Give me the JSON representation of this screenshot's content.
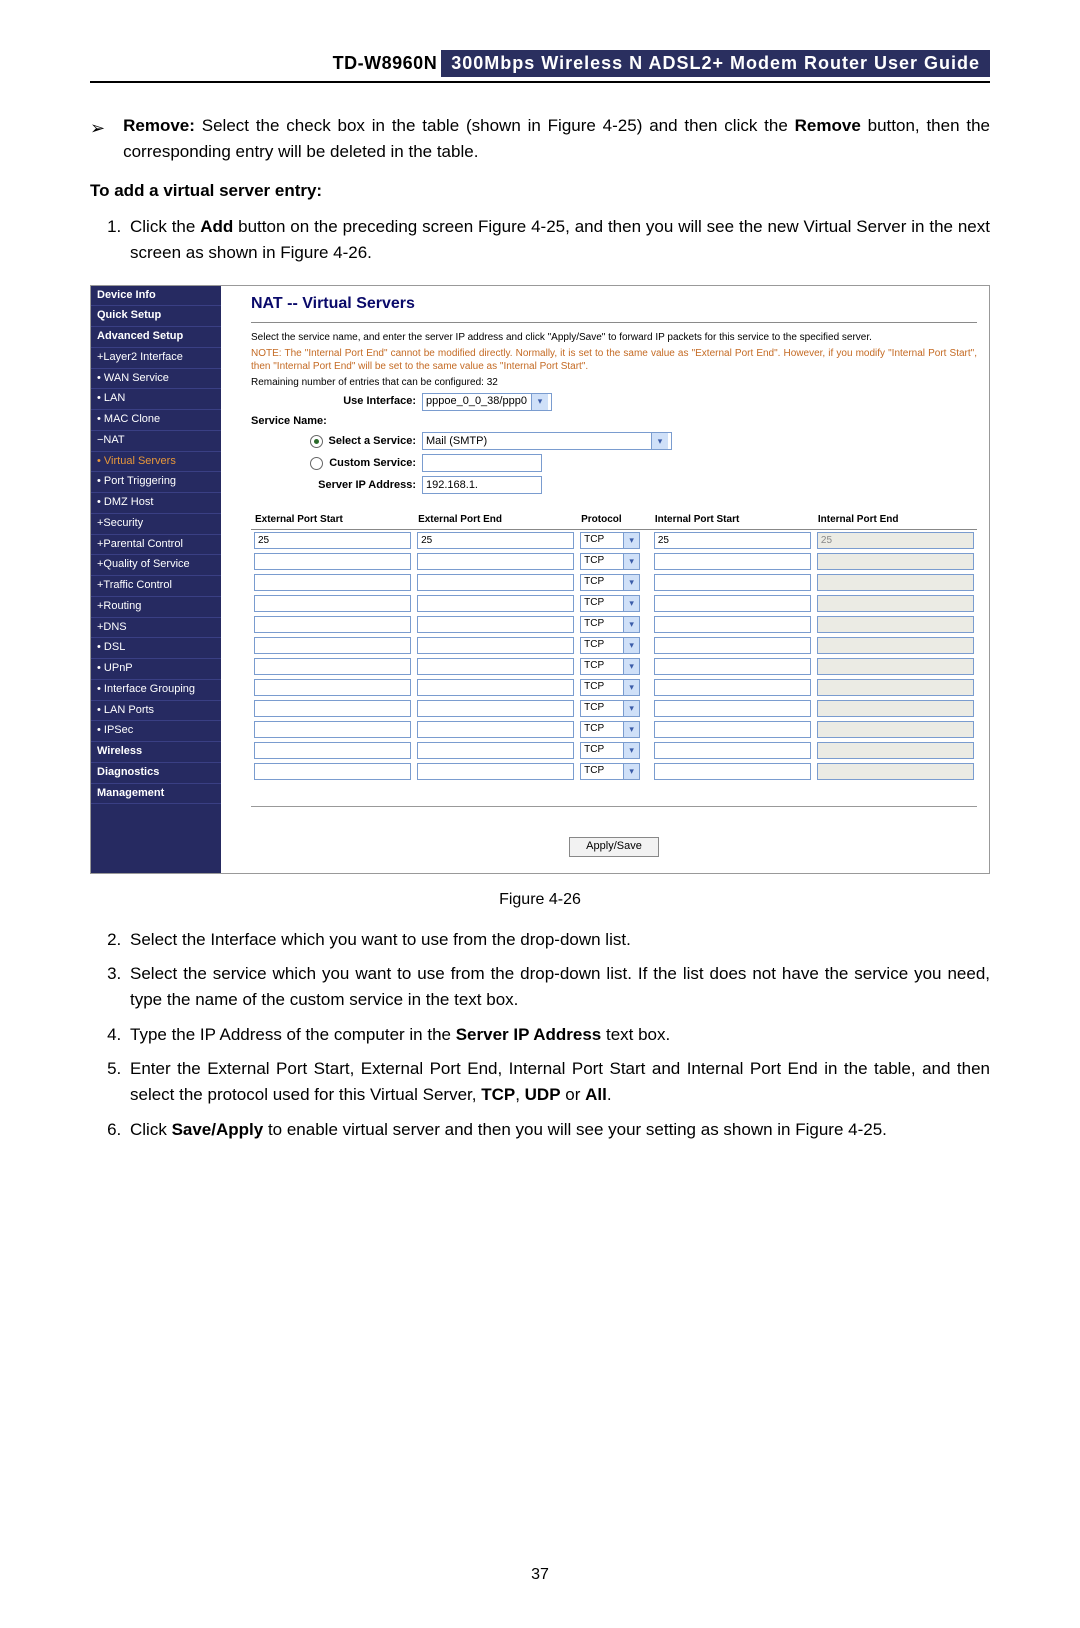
{
  "doc": {
    "model": "TD-W8960N",
    "header_title": "300Mbps Wireless N ADSL2+ Modem Router User Guide",
    "page_number": "37",
    "remove_label": "Remove:",
    "remove_text_1": " Select the check box in the table (shown in Figure 4-25) and then click the ",
    "remove_bold": "Remove",
    "remove_text_2": " button, then the corresponding entry will be deleted in the table.",
    "add_heading": "To add a virtual server entry:",
    "step1_a": "Click the ",
    "step1_b": "Add",
    "step1_c": " button on the preceding screen Figure 4-25, and then you will see the new Virtual Server in the next screen as shown in Figure 4-26.",
    "figure_caption": "Figure 4-26",
    "step2": "Select the Interface which you want to use from the drop-down list.",
    "step3": "Select the service which you want to use from the drop-down list. If the list does not have the service you need, type the name of the custom service in the text box.",
    "step4_a": "Type the IP Address of the computer in the ",
    "step4_b": "Server IP Address",
    "step4_c": " text box.",
    "step5_a": "Enter the External Port Start, External Port End, Internal Port Start and Internal Port End in the table, and then select the protocol used for this Virtual Server, ",
    "step5_b": "TCP",
    "step5_c": ", ",
    "step5_d": "UDP",
    "step5_e": " or ",
    "step5_f": "All",
    "step5_g": ".",
    "step6_a": "Click ",
    "step6_b": "Save/Apply",
    "step6_c": " to enable virtual server and then you will see your setting as shown in Figure 4-25."
  },
  "ui": {
    "nav": [
      {
        "label": "Device Info",
        "cls": ""
      },
      {
        "label": "Quick Setup",
        "cls": ""
      },
      {
        "label": "Advanced Setup",
        "cls": ""
      },
      {
        "label": "+Layer2 Interface",
        "cls": "sub"
      },
      {
        "label": "• WAN Service",
        "cls": "sub"
      },
      {
        "label": "• LAN",
        "cls": "sub"
      },
      {
        "label": "• MAC Clone",
        "cls": "sub"
      },
      {
        "label": "−NAT",
        "cls": "sub"
      },
      {
        "label": "• Virtual Servers",
        "cls": "sub active"
      },
      {
        "label": "• Port Triggering",
        "cls": "sub"
      },
      {
        "label": "• DMZ Host",
        "cls": "sub"
      },
      {
        "label": "+Security",
        "cls": "sub"
      },
      {
        "label": "+Parental Control",
        "cls": "sub"
      },
      {
        "label": "+Quality of Service",
        "cls": "sub"
      },
      {
        "label": "+Traffic Control",
        "cls": "sub"
      },
      {
        "label": "+Routing",
        "cls": "sub"
      },
      {
        "label": "+DNS",
        "cls": "sub"
      },
      {
        "label": "• DSL",
        "cls": "sub"
      },
      {
        "label": "• UPnP",
        "cls": "sub"
      },
      {
        "label": "• Interface Grouping",
        "cls": "sub"
      },
      {
        "label": "• LAN Ports",
        "cls": "sub"
      },
      {
        "label": "• IPSec",
        "cls": "sub"
      },
      {
        "label": "Wireless",
        "cls": ""
      },
      {
        "label": "Diagnostics",
        "cls": ""
      },
      {
        "label": "Management",
        "cls": ""
      }
    ],
    "panel_title": "NAT -- Virtual Servers",
    "help1": "Select the service name, and enter the server IP address and click \"Apply/Save\" to forward IP packets for this service to the specified server.",
    "help2": "NOTE: The \"Internal Port End\" cannot be modified directly. Normally, it is set to the same value as \"External Port End\". However, if you modify \"Internal Port Start\", then \"Internal Port End\" will be set to the same value as \"Internal Port Start\".",
    "help3": "Remaining number of entries that can be configured: 32",
    "labels": {
      "use_interface": "Use Interface:",
      "service_name": "Service Name:",
      "select_service": "Select a Service:",
      "custom_service": "Custom Service:",
      "server_ip": "Server IP Address:"
    },
    "values": {
      "use_interface": "pppoe_0_0_38/ppp0",
      "select_service": "Mail (SMTP)",
      "custom_service": "",
      "server_ip": "192.168.1."
    },
    "table_headers": [
      "External Port Start",
      "External Port End",
      "Protocol",
      "Internal Port Start",
      "Internal Port End"
    ],
    "rows": [
      {
        "eps": "25",
        "epe": "25",
        "proto": "TCP",
        "ips": "25",
        "ipe": "25"
      },
      {
        "eps": "",
        "epe": "",
        "proto": "TCP",
        "ips": "",
        "ipe": ""
      },
      {
        "eps": "",
        "epe": "",
        "proto": "TCP",
        "ips": "",
        "ipe": ""
      },
      {
        "eps": "",
        "epe": "",
        "proto": "TCP",
        "ips": "",
        "ipe": ""
      },
      {
        "eps": "",
        "epe": "",
        "proto": "TCP",
        "ips": "",
        "ipe": ""
      },
      {
        "eps": "",
        "epe": "",
        "proto": "TCP",
        "ips": "",
        "ipe": ""
      },
      {
        "eps": "",
        "epe": "",
        "proto": "TCP",
        "ips": "",
        "ipe": ""
      },
      {
        "eps": "",
        "epe": "",
        "proto": "TCP",
        "ips": "",
        "ipe": ""
      },
      {
        "eps": "",
        "epe": "",
        "proto": "TCP",
        "ips": "",
        "ipe": ""
      },
      {
        "eps": "",
        "epe": "",
        "proto": "TCP",
        "ips": "",
        "ipe": ""
      },
      {
        "eps": "",
        "epe": "",
        "proto": "TCP",
        "ips": "",
        "ipe": ""
      },
      {
        "eps": "",
        "epe": "",
        "proto": "TCP",
        "ips": "",
        "ipe": ""
      }
    ],
    "apply_save": "Apply/Save"
  }
}
